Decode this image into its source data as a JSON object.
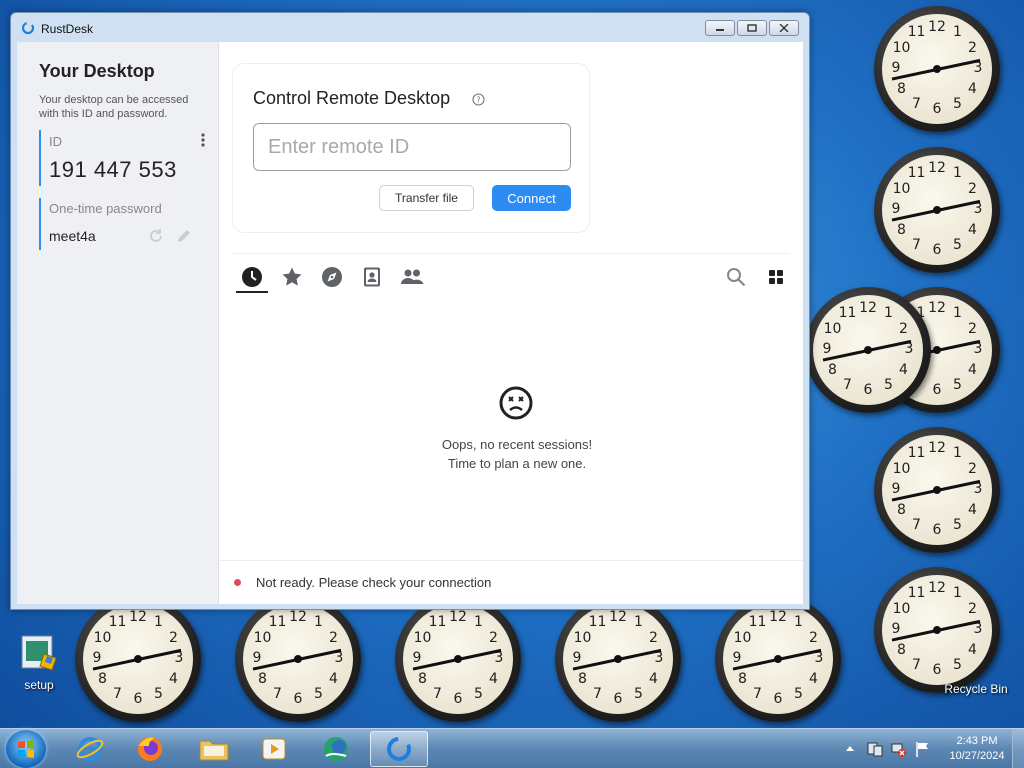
{
  "desktop": {
    "clock_numbers": [
      "12",
      "1",
      "2",
      "3",
      "4",
      "5",
      "6",
      "7",
      "8",
      "9",
      "10",
      "11"
    ],
    "icons": [
      {
        "label": "setup"
      },
      {
        "label": "Recycle Bin"
      }
    ]
  },
  "window": {
    "title": "RustDesk",
    "left": {
      "heading": "Your Desktop",
      "description": "Your desktop can be accessed with this ID and password.",
      "id_label": "ID",
      "id_value": "191 447 553",
      "password_label": "One-time password",
      "password_value": "meet4a"
    },
    "control": {
      "heading": "Control Remote Desktop",
      "input_placeholder": "Enter remote ID",
      "transfer_label": "Transfer file",
      "connect_label": "Connect"
    },
    "tabs": [
      {
        "icon": "recent-sessions-icon"
      },
      {
        "icon": "favorites-star-icon"
      },
      {
        "icon": "discovered-compass-icon"
      },
      {
        "icon": "address-book-icon"
      },
      {
        "icon": "group-icon"
      }
    ],
    "empty_state": {
      "line1": "Oops, no recent sessions!",
      "line2": "Time to plan a new one."
    },
    "status": {
      "text": "Not ready. Please check your connection",
      "color": "#e04a5a"
    },
    "accent_color": "#2c8cf4"
  },
  "taskbar": {
    "time": "2:43 PM",
    "date": "10/27/2024"
  }
}
